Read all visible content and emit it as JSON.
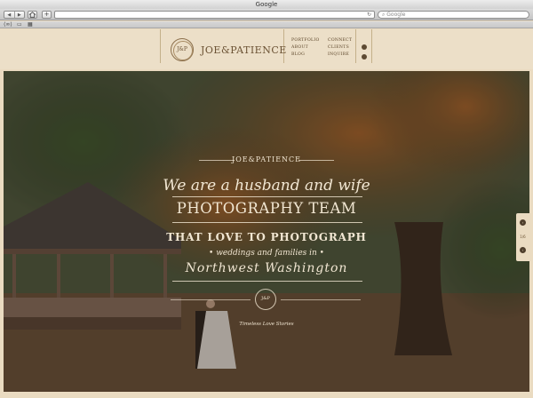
{
  "browser": {
    "title": "Google",
    "nav_back": "◀",
    "nav_forward": "▶",
    "home_icon": "home-icon",
    "add_label": "+",
    "reload_icon": "↻",
    "search_placeholder": "Google",
    "bookmarks": [
      "⟨∞⟩",
      "▭",
      "▦"
    ]
  },
  "site": {
    "seal_text": "J&P",
    "brand": "JOE&PATIENCE",
    "nav_left": [
      "PORTFOLIO",
      "ABOUT",
      "BLOG"
    ],
    "nav_right": [
      "CONNECT",
      "CLIENTS",
      "INQUIRE"
    ],
    "social_icons": [
      "social-icon-1",
      "social-icon-2"
    ],
    "colors": {
      "background": "#eadbc1",
      "text": "#6b5234",
      "hero_text": "#f1e6d2"
    }
  },
  "hero": {
    "brand": "JOE&PATIENCE",
    "line1": "We are a husband and wife",
    "line2": "PHOTOGRAPHY TEAM",
    "line3": "THAT LOVE TO PHOTOGRAPH",
    "line4": "• weddings and families in •",
    "line5": "Northwest Washington",
    "seal_text": "J&P",
    "tagline": "Timeless Love Stories"
  },
  "slider": {
    "prev_icon": "‹",
    "next_icon": "›",
    "count": "1/6"
  }
}
